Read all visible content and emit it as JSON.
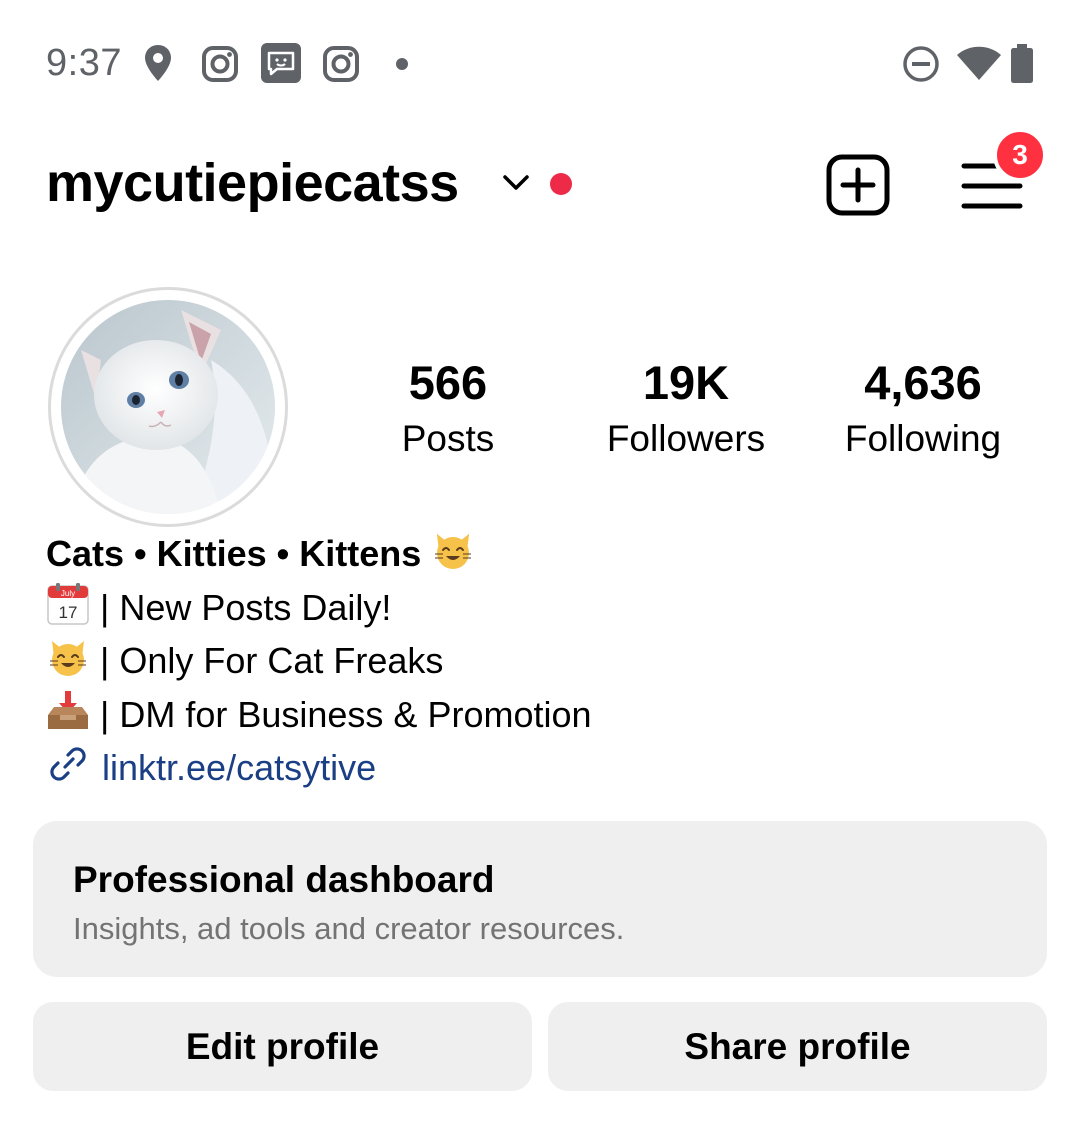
{
  "status_bar": {
    "time": "9:37",
    "left_icons": [
      "location-icon",
      "instagram-icon",
      "messages-icon",
      "instagram-icon",
      "notification-dot"
    ],
    "right_icons": [
      "do-not-disturb-icon",
      "wifi-icon",
      "battery-icon"
    ]
  },
  "header": {
    "username": "mycutiepiecatss",
    "menu_badge": "3"
  },
  "profile": {
    "avatar_alt": "white kitten profile picture",
    "stats": [
      {
        "value": "566",
        "label": "Posts"
      },
      {
        "value": "19K",
        "label": "Followers"
      },
      {
        "value": "4,636",
        "label": "Following"
      }
    ]
  },
  "bio": {
    "name": "Cats • Kitties • Kittens",
    "lines": [
      "| New Posts Daily!",
      "| Only For Cat Freaks",
      "| DM for Business & Promotion"
    ],
    "calendar_month": "July",
    "calendar_day": "17",
    "link": "linktr.ee/catsytive"
  },
  "dashboard": {
    "title": "Professional dashboard",
    "subtitle": "Insights, ad tools and creator resources."
  },
  "actions": {
    "edit_label": "Edit profile",
    "share_label": "Share profile"
  },
  "colors": {
    "notification_red": "#ff3040",
    "live_dot": "#ed2a47",
    "link_blue": "#1a3f84",
    "button_bg": "#efefef"
  }
}
